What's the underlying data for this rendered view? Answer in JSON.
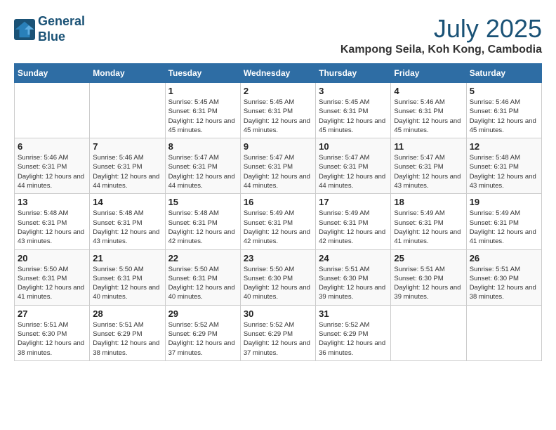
{
  "header": {
    "logo_line1": "General",
    "logo_line2": "Blue",
    "month": "July 2025",
    "location": "Kampong Seila, Koh Kong, Cambodia"
  },
  "weekdays": [
    "Sunday",
    "Monday",
    "Tuesday",
    "Wednesday",
    "Thursday",
    "Friday",
    "Saturday"
  ],
  "weeks": [
    [
      {
        "day": "",
        "info": ""
      },
      {
        "day": "",
        "info": ""
      },
      {
        "day": "1",
        "sunrise": "Sunrise: 5:45 AM",
        "sunset": "Sunset: 6:31 PM",
        "daylight": "Daylight: 12 hours and 45 minutes."
      },
      {
        "day": "2",
        "sunrise": "Sunrise: 5:45 AM",
        "sunset": "Sunset: 6:31 PM",
        "daylight": "Daylight: 12 hours and 45 minutes."
      },
      {
        "day": "3",
        "sunrise": "Sunrise: 5:45 AM",
        "sunset": "Sunset: 6:31 PM",
        "daylight": "Daylight: 12 hours and 45 minutes."
      },
      {
        "day": "4",
        "sunrise": "Sunrise: 5:46 AM",
        "sunset": "Sunset: 6:31 PM",
        "daylight": "Daylight: 12 hours and 45 minutes."
      },
      {
        "day": "5",
        "sunrise": "Sunrise: 5:46 AM",
        "sunset": "Sunset: 6:31 PM",
        "daylight": "Daylight: 12 hours and 45 minutes."
      }
    ],
    [
      {
        "day": "6",
        "sunrise": "Sunrise: 5:46 AM",
        "sunset": "Sunset: 6:31 PM",
        "daylight": "Daylight: 12 hours and 44 minutes."
      },
      {
        "day": "7",
        "sunrise": "Sunrise: 5:46 AM",
        "sunset": "Sunset: 6:31 PM",
        "daylight": "Daylight: 12 hours and 44 minutes."
      },
      {
        "day": "8",
        "sunrise": "Sunrise: 5:47 AM",
        "sunset": "Sunset: 6:31 PM",
        "daylight": "Daylight: 12 hours and 44 minutes."
      },
      {
        "day": "9",
        "sunrise": "Sunrise: 5:47 AM",
        "sunset": "Sunset: 6:31 PM",
        "daylight": "Daylight: 12 hours and 44 minutes."
      },
      {
        "day": "10",
        "sunrise": "Sunrise: 5:47 AM",
        "sunset": "Sunset: 6:31 PM",
        "daylight": "Daylight: 12 hours and 44 minutes."
      },
      {
        "day": "11",
        "sunrise": "Sunrise: 5:47 AM",
        "sunset": "Sunset: 6:31 PM",
        "daylight": "Daylight: 12 hours and 43 minutes."
      },
      {
        "day": "12",
        "sunrise": "Sunrise: 5:48 AM",
        "sunset": "Sunset: 6:31 PM",
        "daylight": "Daylight: 12 hours and 43 minutes."
      }
    ],
    [
      {
        "day": "13",
        "sunrise": "Sunrise: 5:48 AM",
        "sunset": "Sunset: 6:31 PM",
        "daylight": "Daylight: 12 hours and 43 minutes."
      },
      {
        "day": "14",
        "sunrise": "Sunrise: 5:48 AM",
        "sunset": "Sunset: 6:31 PM",
        "daylight": "Daylight: 12 hours and 43 minutes."
      },
      {
        "day": "15",
        "sunrise": "Sunrise: 5:48 AM",
        "sunset": "Sunset: 6:31 PM",
        "daylight": "Daylight: 12 hours and 42 minutes."
      },
      {
        "day": "16",
        "sunrise": "Sunrise: 5:49 AM",
        "sunset": "Sunset: 6:31 PM",
        "daylight": "Daylight: 12 hours and 42 minutes."
      },
      {
        "day": "17",
        "sunrise": "Sunrise: 5:49 AM",
        "sunset": "Sunset: 6:31 PM",
        "daylight": "Daylight: 12 hours and 42 minutes."
      },
      {
        "day": "18",
        "sunrise": "Sunrise: 5:49 AM",
        "sunset": "Sunset: 6:31 PM",
        "daylight": "Daylight: 12 hours and 41 minutes."
      },
      {
        "day": "19",
        "sunrise": "Sunrise: 5:49 AM",
        "sunset": "Sunset: 6:31 PM",
        "daylight": "Daylight: 12 hours and 41 minutes."
      }
    ],
    [
      {
        "day": "20",
        "sunrise": "Sunrise: 5:50 AM",
        "sunset": "Sunset: 6:31 PM",
        "daylight": "Daylight: 12 hours and 41 minutes."
      },
      {
        "day": "21",
        "sunrise": "Sunrise: 5:50 AM",
        "sunset": "Sunset: 6:31 PM",
        "daylight": "Daylight: 12 hours and 40 minutes."
      },
      {
        "day": "22",
        "sunrise": "Sunrise: 5:50 AM",
        "sunset": "Sunset: 6:31 PM",
        "daylight": "Daylight: 12 hours and 40 minutes."
      },
      {
        "day": "23",
        "sunrise": "Sunrise: 5:50 AM",
        "sunset": "Sunset: 6:30 PM",
        "daylight": "Daylight: 12 hours and 40 minutes."
      },
      {
        "day": "24",
        "sunrise": "Sunrise: 5:51 AM",
        "sunset": "Sunset: 6:30 PM",
        "daylight": "Daylight: 12 hours and 39 minutes."
      },
      {
        "day": "25",
        "sunrise": "Sunrise: 5:51 AM",
        "sunset": "Sunset: 6:30 PM",
        "daylight": "Daylight: 12 hours and 39 minutes."
      },
      {
        "day": "26",
        "sunrise": "Sunrise: 5:51 AM",
        "sunset": "Sunset: 6:30 PM",
        "daylight": "Daylight: 12 hours and 38 minutes."
      }
    ],
    [
      {
        "day": "27",
        "sunrise": "Sunrise: 5:51 AM",
        "sunset": "Sunset: 6:30 PM",
        "daylight": "Daylight: 12 hours and 38 minutes."
      },
      {
        "day": "28",
        "sunrise": "Sunrise: 5:51 AM",
        "sunset": "Sunset: 6:29 PM",
        "daylight": "Daylight: 12 hours and 38 minutes."
      },
      {
        "day": "29",
        "sunrise": "Sunrise: 5:52 AM",
        "sunset": "Sunset: 6:29 PM",
        "daylight": "Daylight: 12 hours and 37 minutes."
      },
      {
        "day": "30",
        "sunrise": "Sunrise: 5:52 AM",
        "sunset": "Sunset: 6:29 PM",
        "daylight": "Daylight: 12 hours and 37 minutes."
      },
      {
        "day": "31",
        "sunrise": "Sunrise: 5:52 AM",
        "sunset": "Sunset: 6:29 PM",
        "daylight": "Daylight: 12 hours and 36 minutes."
      },
      {
        "day": "",
        "info": ""
      },
      {
        "day": "",
        "info": ""
      }
    ]
  ]
}
